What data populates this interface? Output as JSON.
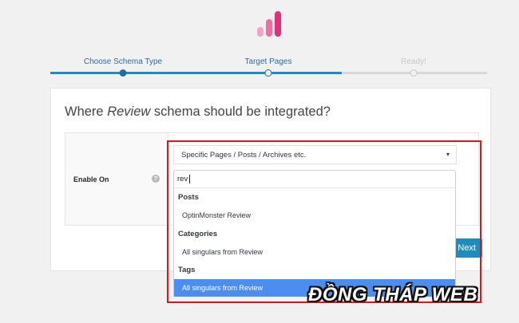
{
  "stepper": {
    "steps": [
      {
        "label": "Choose Schema Type",
        "state": "complete"
      },
      {
        "label": "Target Pages",
        "state": "current"
      },
      {
        "label": "Ready!",
        "state": "upcoming"
      }
    ]
  },
  "card": {
    "heading_pre": "Where ",
    "heading_emph": "Review",
    "heading_post": " schema should be integrated?",
    "enable_label": "Enable On",
    "help_icon_text": "?",
    "next_label": "Next"
  },
  "dropdown": {
    "selected": "Specific Pages / Posts / Archives etc.",
    "caret": "▾",
    "search_value": "rev",
    "groups": [
      {
        "label": "Posts",
        "options": [
          "OptinMonster Review"
        ]
      },
      {
        "label": "Categories",
        "options": [
          "All singulars from Review"
        ]
      },
      {
        "label": "Tags",
        "options": [
          "All singulars from Review"
        ]
      }
    ],
    "highlighted": "All singulars from Review"
  },
  "watermark": "ĐỒNG THÁP WEB",
  "colors": {
    "accent": "#1e8cbe",
    "highlight": "#4c8ef0",
    "annotation": "#e0141b",
    "logo_pink": "#e0307a"
  }
}
